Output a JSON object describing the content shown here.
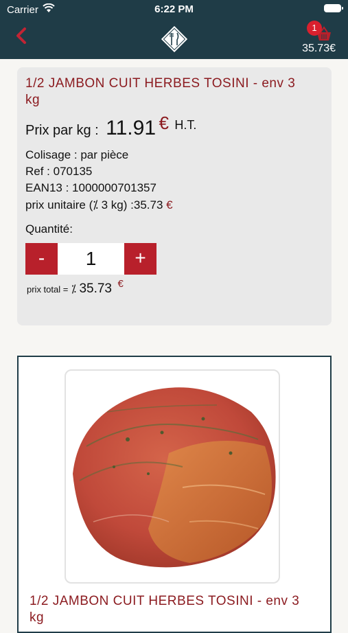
{
  "status": {
    "carrier": "Carrier",
    "time": "6:22 PM"
  },
  "header": {
    "cart_count": "1",
    "cart_total": "35.73€"
  },
  "product": {
    "title": "1/2 JAMBON CUIT HERBES TOSINI - env 3 kg",
    "price_label": "Prix par kg :",
    "price_value": "11.91",
    "currency": "€",
    "price_suffix": "H.T.",
    "colisage": "Colisage : par pièce",
    "ref": "Ref : 070135",
    "ean": "EAN13 : 1000000701357",
    "unit_price_text": "prix unitaire (⁒ 3 kg) :35.73",
    "quantity_label": "Quantité:",
    "minus_label": "-",
    "plus_label": "+",
    "quantity_value": "1",
    "total_label": "prix total =",
    "total_approx": "⁒",
    "total_value": "35.73"
  },
  "panel": {
    "image_alt": "ham-photo",
    "title": "1/2 JAMBON CUIT HERBES TOSINI - env 3 kg"
  },
  "colors": {
    "header_bg": "#1f3c47",
    "accent_red": "#b8202b",
    "title_red": "#8b1a1f",
    "badge_red": "#d9202e"
  }
}
